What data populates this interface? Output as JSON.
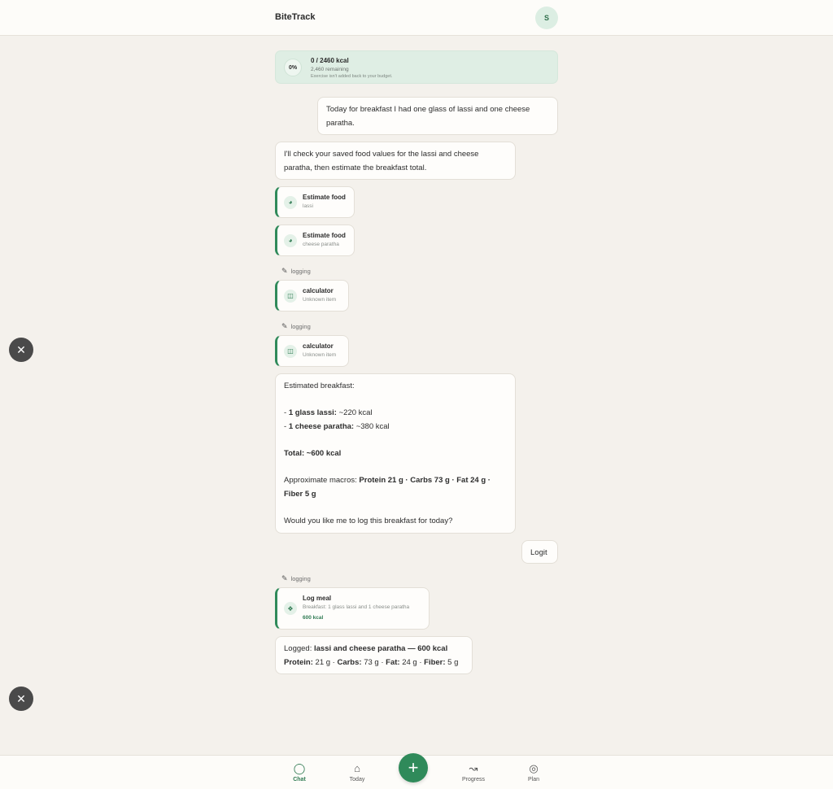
{
  "header": {
    "title": "BiteTrack",
    "avatar_initial": "S"
  },
  "budget": {
    "percent": "0%",
    "summary": "0 / 2460 kcal",
    "remaining": "2,460 remaining",
    "note": "Exercise isn't added back to your budget."
  },
  "messages": {
    "user_1": "Today for breakfast I had one glass of lassi and one cheese paratha.",
    "assistant_1": "I'll check your saved food values for the lassi and cheese paratha, then estimate the breakfast total.",
    "tool_1": {
      "title": "Estimate food",
      "subtitle": "lassi",
      "icon": "food-icon"
    },
    "tool_2": {
      "title": "Estimate food",
      "subtitle": "cheese paratha",
      "icon": "food-icon"
    },
    "logging_label": "logging",
    "tool_3": {
      "title": "calculator",
      "subtitle": "Unknown item",
      "icon": "calculator-icon"
    },
    "tool_4": {
      "title": "calculator",
      "subtitle": "Unknown item",
      "icon": "calculator-icon"
    },
    "assistant_2": {
      "intro": "Estimated breakfast:",
      "item1_label": "1 glass lassi:",
      "item1_value": " ~220 kcal",
      "item2_label": "1 cheese paratha:",
      "item2_value": " ~380 kcal",
      "total": "Total: ~600 kcal",
      "macros_prefix": "Approximate macros: ",
      "macros_line1": "Protein 21 g · Carbs 73 g · Fat 24 g ·",
      "macros_line2": "Fiber 5 g",
      "question": "Would you like me to log this breakfast for today?"
    },
    "user_2": "Logit",
    "tool_5": {
      "title": "Log meal",
      "subtitle": "Breakfast: 1 glass lassi and 1 cheese paratha",
      "kcal": "600 kcal",
      "icon": "log-meal-icon"
    },
    "assistant_3": {
      "prefix": "Logged: ",
      "meal": "lassi and cheese paratha — 600 kcal",
      "protein_label": "Protein:",
      "protein_value": " 21 g · ",
      "carbs_label": "Carbs:",
      "carbs_value": " 73 g · ",
      "fat_label": "Fat:",
      "fat_value": " 24 g · ",
      "fiber_label": "Fiber:",
      "fiber_value": " 5 g"
    }
  },
  "nav": {
    "chat": "Chat",
    "today": "Today",
    "progress": "Progress",
    "plan": "Plan"
  },
  "colors": {
    "accent": "#2f8a5a",
    "background": "#f4f1ec",
    "budget_bg": "#dfeee4"
  }
}
